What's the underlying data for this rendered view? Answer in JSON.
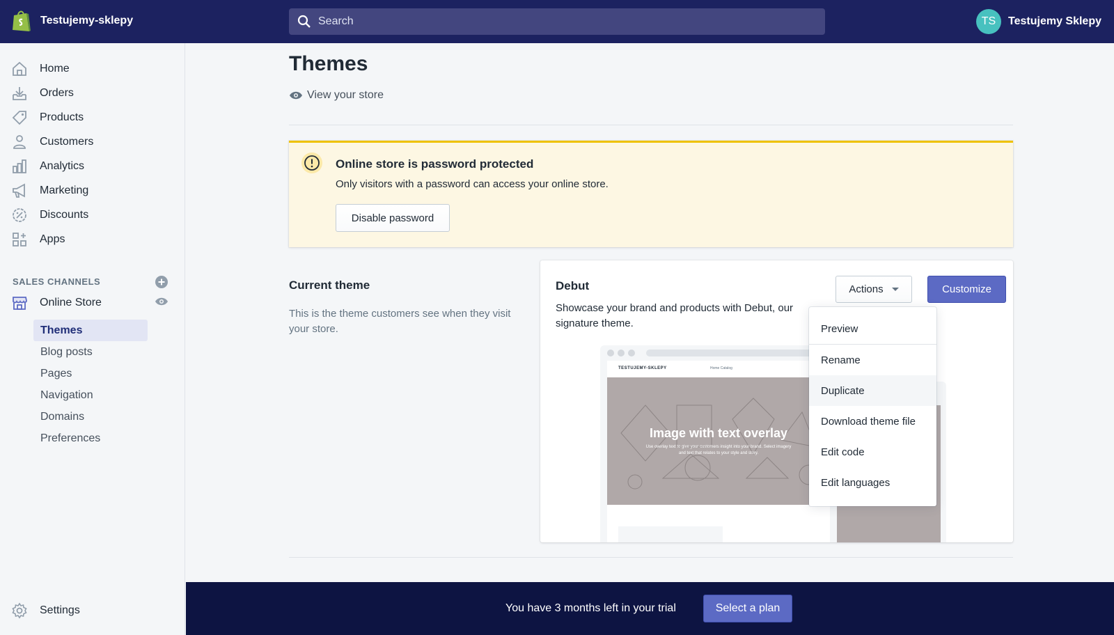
{
  "topbar": {
    "store_name": "Testujemy-sklepy",
    "search_placeholder": "Search",
    "user_initials": "TS",
    "user_name": "Testujemy Sklepy"
  },
  "sidebar": {
    "items": [
      {
        "label": "Home",
        "icon": "home-icon"
      },
      {
        "label": "Orders",
        "icon": "orders-icon"
      },
      {
        "label": "Products",
        "icon": "tag-icon"
      },
      {
        "label": "Customers",
        "icon": "person-icon"
      },
      {
        "label": "Analytics",
        "icon": "bar-chart-icon"
      },
      {
        "label": "Marketing",
        "icon": "megaphone-icon"
      },
      {
        "label": "Discounts",
        "icon": "discount-icon"
      },
      {
        "label": "Apps",
        "icon": "apps-icon"
      }
    ],
    "sales_channels_title": "SALES CHANNELS",
    "online_store_label": "Online Store",
    "sub_items": [
      {
        "label": "Themes",
        "active": true
      },
      {
        "label": "Blog posts"
      },
      {
        "label": "Pages"
      },
      {
        "label": "Navigation"
      },
      {
        "label": "Domains"
      },
      {
        "label": "Preferences"
      }
    ],
    "settings_label": "Settings"
  },
  "main": {
    "title": "Themes",
    "view_store": "View your store",
    "banner": {
      "title": "Online store is password protected",
      "text": "Only visitors with a password can access your online store.",
      "button": "Disable password"
    },
    "current_theme": {
      "title": "Current theme",
      "description": "This is the theme customers see when they visit your store."
    },
    "theme_card": {
      "name": "Debut",
      "description": "Showcase your brand and products with Debut, our signature theme.",
      "actions_label": "Actions",
      "customize_label": "Customize",
      "preview": {
        "store_header": "TESTUJEMY-SKLEPY",
        "nav_links": "Home   Catalog",
        "hero_title": "Image with text overlay",
        "hero_subtitle": "Use overlay text to give your customers insight into your brand. Select imagery and text that relates to your style and story."
      }
    },
    "actions_menu": [
      "Preview",
      "Rename",
      "Duplicate",
      "Download theme file",
      "Edit code",
      "Edit languages"
    ]
  },
  "trial": {
    "text": "You have 3 months left in your trial",
    "button": "Select a plan"
  },
  "colors": {
    "topbar": "#1c2260",
    "primary": "#5c6ac4",
    "banner_bg": "#fdf7e3",
    "banner_accent": "#eec200",
    "trial_bar": "#0d1442"
  }
}
